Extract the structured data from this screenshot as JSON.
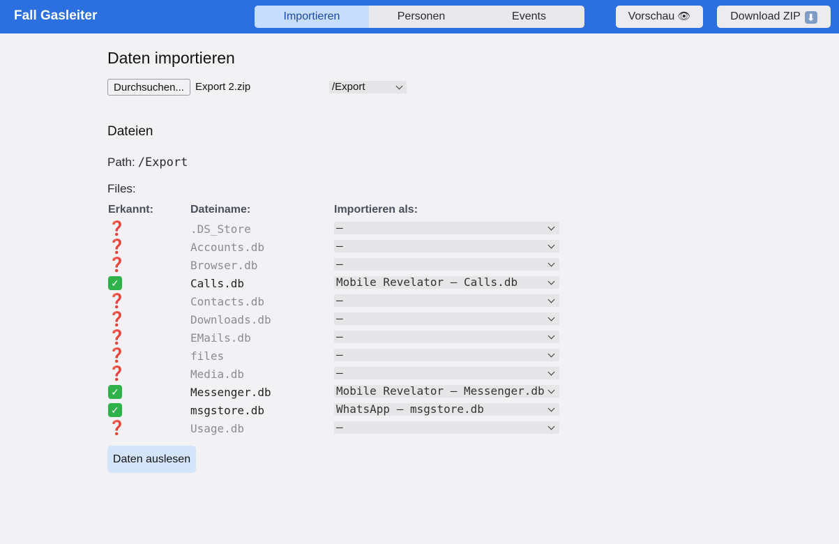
{
  "app": {
    "title": "Fall Gasleiter"
  },
  "nav": {
    "tabs": [
      {
        "label": "Importieren",
        "active": true
      },
      {
        "label": "Personen",
        "active": false
      },
      {
        "label": "Events",
        "active": false
      }
    ],
    "preview_label": "Vorschau",
    "preview_icon": "eye-icon",
    "download_label": "Download ZIP",
    "download_icon": "down-arrow-icon",
    "download_glyph": "⬇"
  },
  "import": {
    "title": "Daten importieren",
    "browse_label": "Durchsuchen...",
    "selected_file": "Export 2.zip",
    "path_select_value": "/Export"
  },
  "files_section": {
    "title": "Dateien",
    "path_label": "Path:",
    "path_value": "/Export",
    "files_label": "Files:",
    "columns": [
      "Erkannt:",
      "Dateiname:",
      "Importieren als:"
    ],
    "rows": [
      {
        "recognized": false,
        "status_glyph": "❓",
        "name": ".DS_Store",
        "import_as": "–"
      },
      {
        "recognized": false,
        "status_glyph": "❓",
        "name": "Accounts.db",
        "import_as": "–"
      },
      {
        "recognized": false,
        "status_glyph": "❓",
        "name": "Browser.db",
        "import_as": "–"
      },
      {
        "recognized": true,
        "status_glyph": "✓",
        "name": "Calls.db",
        "import_as": "Mobile Revelator – Calls.db"
      },
      {
        "recognized": false,
        "status_glyph": "❓",
        "name": "Contacts.db",
        "import_as": "–"
      },
      {
        "recognized": false,
        "status_glyph": "❓",
        "name": "Downloads.db",
        "import_as": "–"
      },
      {
        "recognized": false,
        "status_glyph": "❓",
        "name": "EMails.db",
        "import_as": "–"
      },
      {
        "recognized": false,
        "status_glyph": "❓",
        "name": "files",
        "import_as": "–"
      },
      {
        "recognized": false,
        "status_glyph": "❓",
        "name": "Media.db",
        "import_as": "–"
      },
      {
        "recognized": true,
        "status_glyph": "✓",
        "name": "Messenger.db",
        "import_as": "Mobile Revelator – Messenger.db"
      },
      {
        "recognized": true,
        "status_glyph": "✓",
        "name": "msgstore.db",
        "import_as": "WhatsApp – msgstore.db"
      },
      {
        "recognized": false,
        "status_glyph": "❓",
        "name": "Usage.db",
        "import_as": "–"
      }
    ],
    "submit_label": "Daten auslesen"
  },
  "colors": {
    "header_bg": "#2b6fe0",
    "active_tab_bg": "#c7ddfb",
    "unknown_status": "#d21f1f",
    "known_status": "#2fb24a",
    "submit_bg": "#d4e5fb"
  }
}
